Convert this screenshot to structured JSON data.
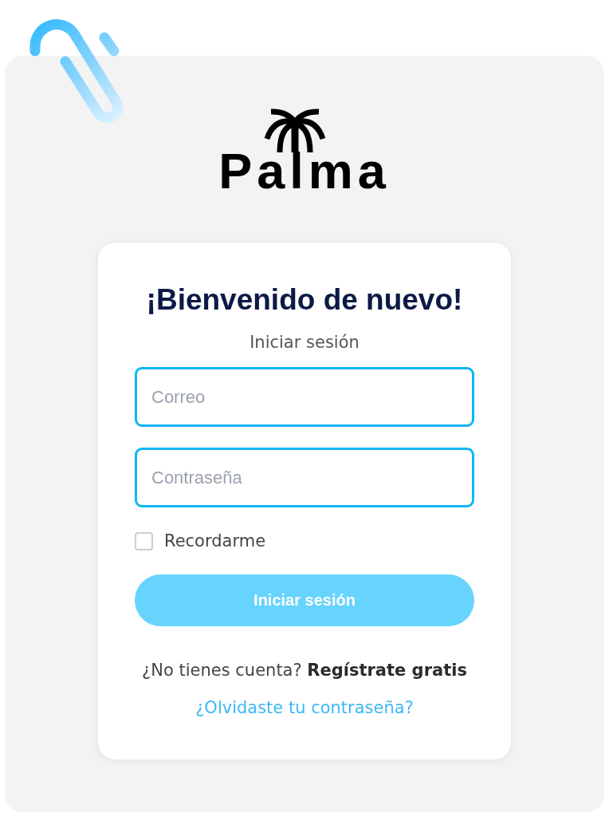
{
  "logo": {
    "text": "Palma"
  },
  "login_card": {
    "title": "¡Bienvenido de nuevo!",
    "subtitle": "Iniciar sesión",
    "fields": [
      {
        "placeholder": "Correo"
      },
      {
        "placeholder": "Contraseña"
      }
    ],
    "remember_me": {
      "label": "Recordarme",
      "checked": false
    },
    "submit_button": {
      "label": "Iniciar sesión",
      "disabled": true
    },
    "signup_prompt": {
      "text": "¿No tienes cuenta?",
      "link": "Regístrate gratis"
    },
    "forgot_password_link": "¿Olvidaste tu contraseña?"
  }
}
